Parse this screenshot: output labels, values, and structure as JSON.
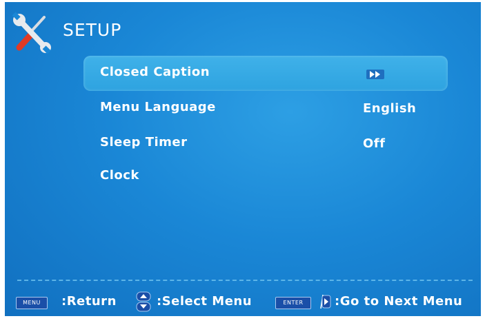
{
  "header": {
    "title": "SETUP",
    "icon": "tools-icon"
  },
  "menu": {
    "items": [
      {
        "label": "Closed Caption",
        "value": "",
        "value_icon": "double-right-arrow-icon",
        "selected": true
      },
      {
        "label": "Menu Language",
        "value": "English",
        "selected": false
      },
      {
        "label": "Sleep Timer",
        "value": "Off",
        "selected": false
      },
      {
        "label": "Clock",
        "value": "",
        "selected": false
      }
    ]
  },
  "footer": {
    "menu_key": "MENU",
    "return_label": ":Return",
    "select_label": ":Select Menu",
    "enter_key": "ENTER",
    "next_label": ":Go to Next Menu"
  },
  "colors": {
    "background": "#1a87d6",
    "highlight": "#3fb1e9",
    "key": "#1a4fa8"
  }
}
